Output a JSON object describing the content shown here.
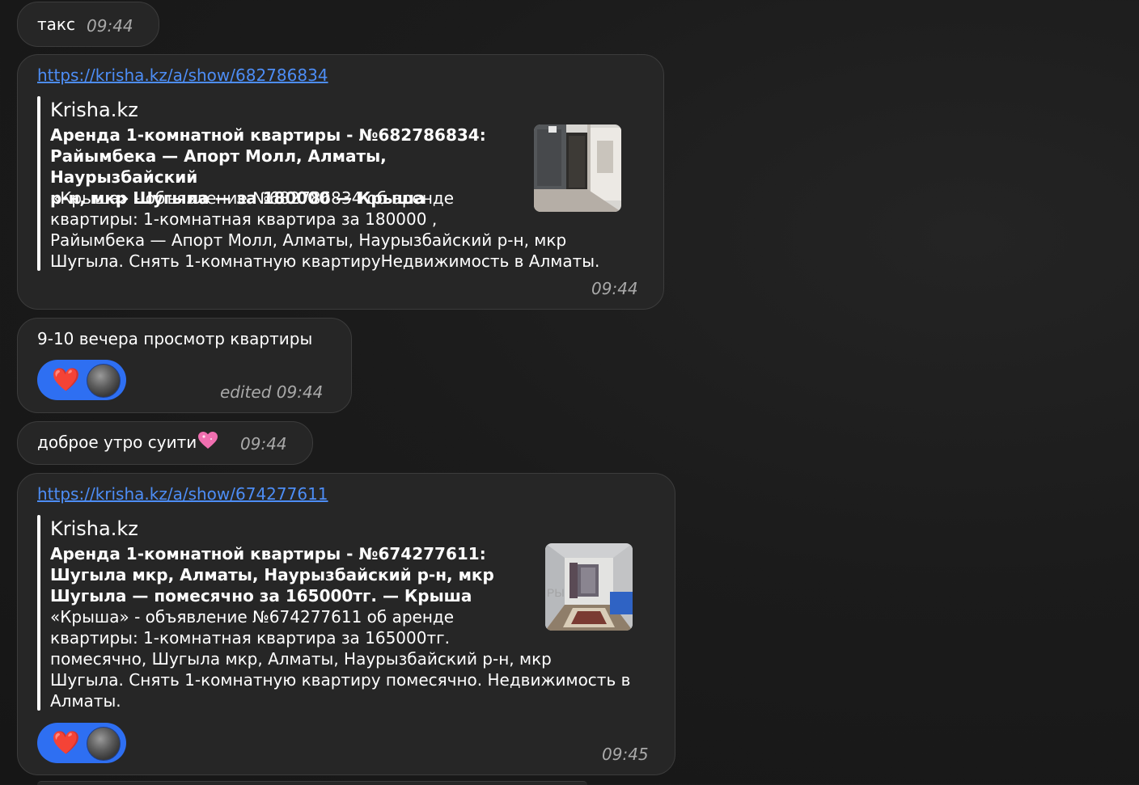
{
  "messages": [
    {
      "text": "такс",
      "time": "09:44"
    },
    {
      "link": "https://krisha.kz/a/show/682786834",
      "preview": {
        "site": "Krisha.kz",
        "title": "Аренда 1-комнатной квартиры - №682786834:\nРайымбека — Апорт Молл, Алматы, Наурызбайский\nр-н, мкр Шугыла — за 180000 — Крыша",
        "description": "«Крыша» - объявление №682786834 об аренде\nквартиры: 1-комнатная квартира за 180000 ,\nРайымбека — Апорт Молл, Алматы, Наурызбайский р-н, мкр\nШугыла. Снять 1-комнатную квартируНедвижимость в Алматы.",
        "thumbnail": "apartment-hallway-photo"
      },
      "time": "09:44"
    },
    {
      "text": "9-10 вечера просмотр квартиры",
      "reaction": {
        "emoji": "❤️",
        "icon": "heart-reaction"
      },
      "time": "edited 09:44"
    },
    {
      "text": "доброе утро суити",
      "emoji": "💗",
      "time": "09:44"
    },
    {
      "link": "https://krisha.kz/a/show/674277611",
      "preview": {
        "site": "Krisha.kz",
        "title": "Аренда 1-комнатной квартиры - №674277611:\nШугыла мкр, Алматы, Наурызбайский р-н, мкр\nШугыла — помесячно за 165000тг. — Крыша",
        "description": "«Крыша» - объявление №674277611 об аренде\nквартиры: 1-комнатная квартира за 165000тг.\nпомесячно, Шугыла мкр, Алматы, Наурызбайский р-н, мкр\nШугыла. Снять 1-комнатную квартиру помесячно. Недвижимость в\nАлматы.",
        "thumbnail": "apartment-room-photo"
      },
      "reaction": {
        "emoji": "❤️",
        "icon": "heart-reaction"
      },
      "time": "09:45"
    }
  ],
  "colors": {
    "background": "#1b1b1b",
    "bubble": "#262626",
    "link": "#4d8df5",
    "reaction": "#2e6ff2"
  }
}
